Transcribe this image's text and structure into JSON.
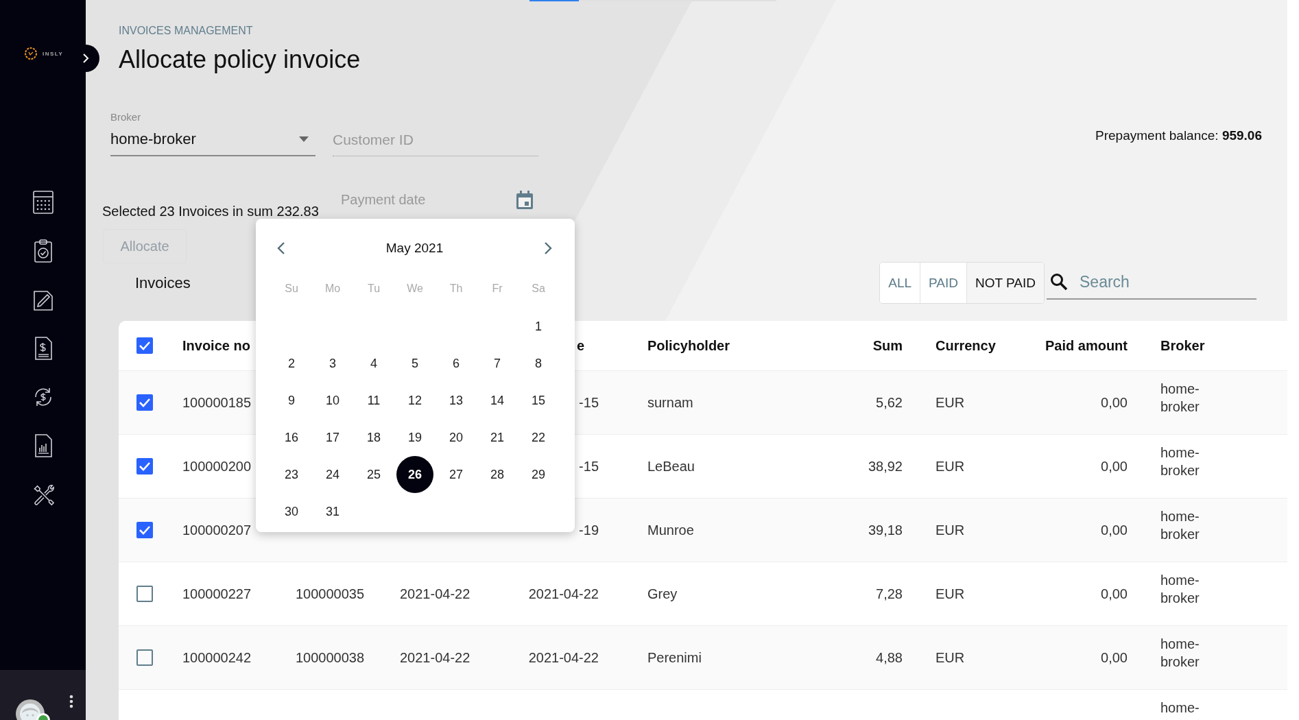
{
  "sidebar": {
    "logo_text": "INSLY",
    "user": {
      "online": true
    }
  },
  "header": {
    "section": "INVOICES MANAGEMENT",
    "title": "Allocate policy invoice"
  },
  "form": {
    "broker": {
      "label": "Broker",
      "value": "home-broker"
    },
    "customer_id": {
      "placeholder": "Customer ID"
    },
    "prepayment": "Prepayment balance: **959.06**"
  },
  "selection": {
    "summary": "Selected 23 Invoices in sum 232.83",
    "payment_date": {
      "placeholder": "Payment date"
    },
    "allocate": {
      "label": "Allocate",
      "disabled": true
    }
  },
  "invoices": {
    "title": "Invoices",
    "filters": [
      {
        "label": "ALL",
        "selected": false
      },
      {
        "label": "PAID",
        "selected": false
      },
      {
        "label": "NOT PAID",
        "selected": true
      }
    ],
    "search": {
      "placeholder": "Search"
    }
  },
  "table": {
    "all_checked": true,
    "columns": {
      "invoice_no": "Invoice no",
      "column_4": "e",
      "policyholder": "Policyholder",
      "sum": "Sum",
      "currency": "Currency",
      "paid_amount": "Paid amount",
      "broker": "Broker"
    },
    "rows": [
      {
        "checked": true,
        "invoice_no": "100000185",
        "column_4": "-15",
        "policyholder": "surnam",
        "sum": "5,62",
        "currency": "EUR",
        "paid_amount": "0,00",
        "broker": "home-broker"
      },
      {
        "checked": true,
        "invoice_no": "100000200",
        "column_4": "-15",
        "policyholder": "LeBeau",
        "sum": "38,92",
        "currency": "EUR",
        "paid_amount": "0,00",
        "broker": "home-broker"
      },
      {
        "checked": true,
        "invoice_no": "100000207",
        "column_4": "-19",
        "policyholder": "Munroe",
        "sum": "39,18",
        "currency": "EUR",
        "paid_amount": "0,00",
        "broker": "home-broker"
      },
      {
        "checked": false,
        "invoice_no": "100000227",
        "column_2": "100000035",
        "column_3": "2021-04-22",
        "column_4": "2021-04-22",
        "policyholder": "Grey",
        "sum": "7,28",
        "currency": "EUR",
        "paid_amount": "0,00",
        "broker": "home-broker"
      },
      {
        "checked": false,
        "invoice_no": "100000242",
        "column_2": "100000038",
        "column_3": "2021-04-22",
        "column_4": "2021-04-22",
        "policyholder": "Perenimi",
        "sum": "4,88",
        "currency": "EUR",
        "paid_amount": "0,00",
        "broker": "home-broker"
      },
      {
        "broker": "home-"
      }
    ]
  },
  "calendar": {
    "month": "May 2021",
    "weekdays": [
      "Su",
      "Mo",
      "Tu",
      "We",
      "Th",
      "Fr",
      "Sa"
    ],
    "weeks": [
      [
        {
          "day": "1",
          "selected": false
        }
      ],
      [
        {
          "day": "2",
          "selected": false
        },
        {
          "day": "3",
          "selected": false
        },
        {
          "day": "4",
          "selected": false
        },
        {
          "day": "5",
          "selected": false
        },
        {
          "day": "6",
          "selected": false
        },
        {
          "day": "7",
          "selected": false
        },
        {
          "day": "8",
          "selected": false
        }
      ],
      [
        {
          "day": "9",
          "selected": false
        },
        {
          "day": "10",
          "selected": false
        },
        {
          "day": "11",
          "selected": false
        },
        {
          "day": "12",
          "selected": false
        },
        {
          "day": "13",
          "selected": false
        },
        {
          "day": "14",
          "selected": false
        },
        {
          "day": "15",
          "selected": false
        }
      ],
      [
        {
          "day": "16",
          "selected": false
        },
        {
          "day": "17",
          "selected": false
        },
        {
          "day": "18",
          "selected": false
        },
        {
          "day": "19",
          "selected": false
        },
        {
          "day": "20",
          "selected": false
        },
        {
          "day": "21",
          "selected": false
        },
        {
          "day": "22",
          "selected": false
        }
      ],
      [
        {
          "day": "23",
          "selected": false
        },
        {
          "day": "24",
          "selected": false
        },
        {
          "day": "25",
          "selected": false
        },
        {
          "day": "26",
          "selected": true
        },
        {
          "day": "27",
          "selected": false
        },
        {
          "day": "28",
          "selected": false
        },
        {
          "day": "29",
          "selected": false
        }
      ],
      [
        {
          "day": "30",
          "selected": false
        },
        {
          "day": "31",
          "selected": false
        }
      ]
    ]
  }
}
